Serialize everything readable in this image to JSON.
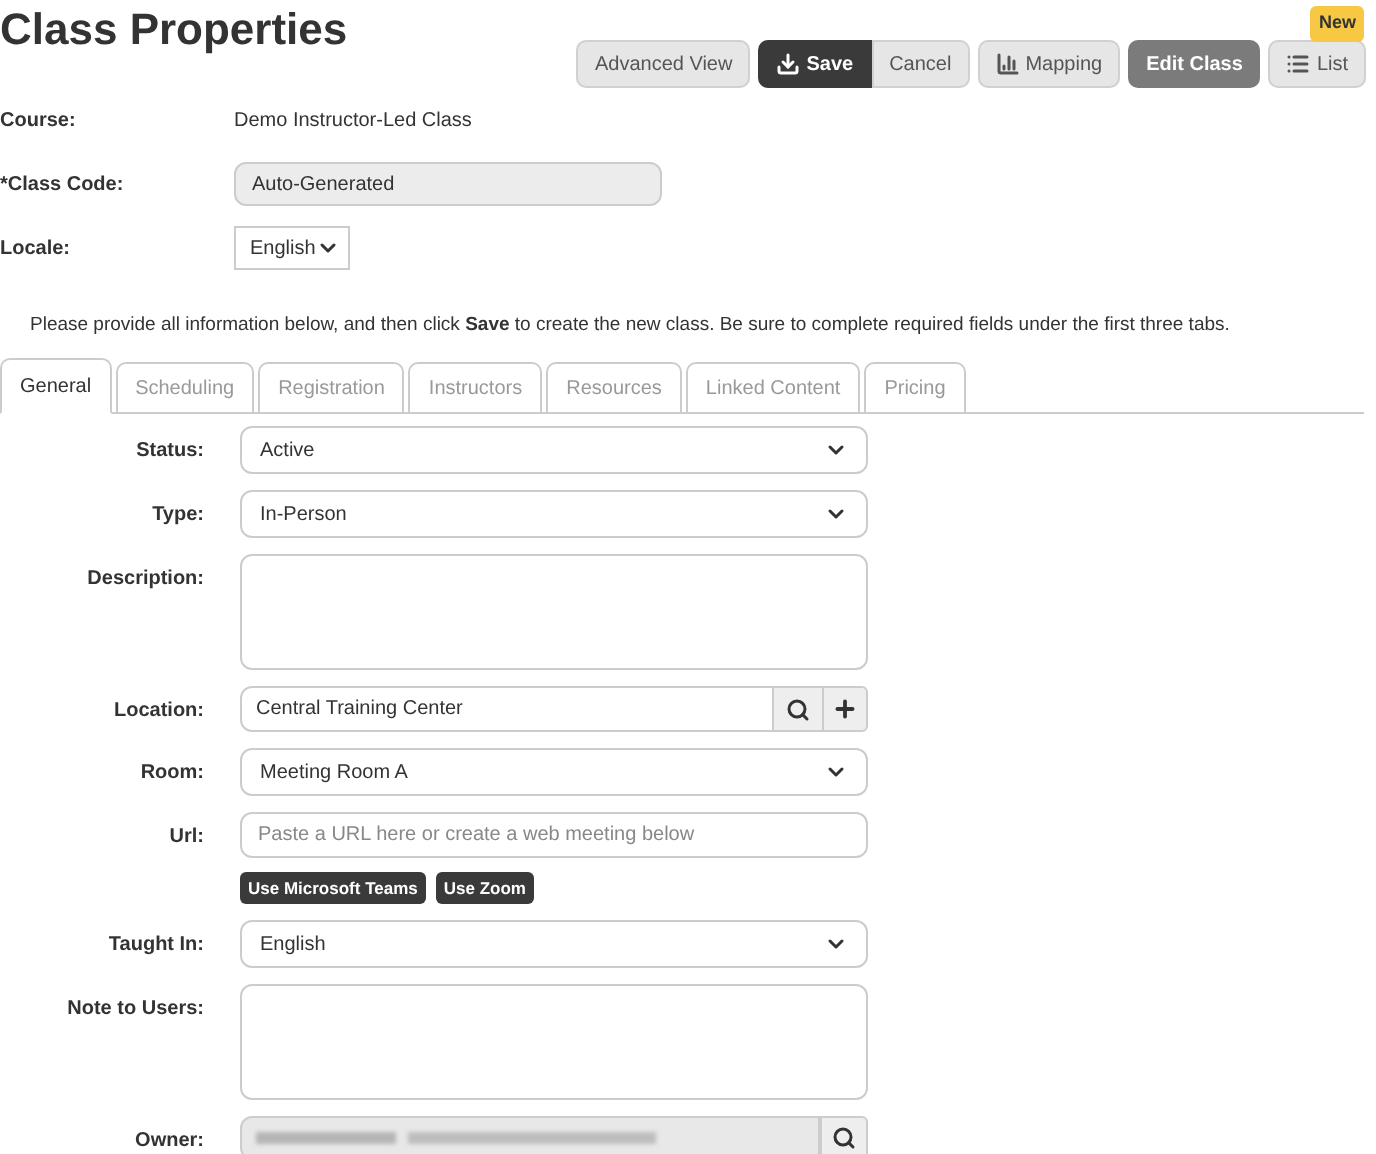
{
  "page": {
    "title": "Class Properties",
    "badge": "New"
  },
  "toolbar": [
    [
      {
        "label": "Advanced View",
        "kind": "view"
      }
    ],
    [
      {
        "label": "Save",
        "kind": "save"
      },
      {
        "label": "Cancel",
        "kind": "cancel"
      }
    ],
    [
      {
        "label": "Mapping",
        "kind": "mapping"
      }
    ],
    [
      {
        "label": "Edit Class",
        "kind": "edit"
      }
    ],
    [
      {
        "label": "List",
        "kind": "list"
      }
    ]
  ],
  "header_fields": [
    {
      "label": "Course:",
      "kind": "static",
      "value": "Demo Instructor-Led Class"
    },
    {
      "label": "*Class Code:",
      "kind": "readonly",
      "value": "Auto-Generated"
    },
    {
      "label": "Locale:",
      "kind": "small-select",
      "value": "English"
    }
  ],
  "info": "Please provide all information below, and then click **Save** to create the new class. Be sure to complete required fields under the first three tabs.",
  "tabs": [
    {
      "label": "General",
      "selected": true
    },
    {
      "label": "Scheduling",
      "selected": false
    },
    {
      "label": "Registration",
      "selected": false
    },
    {
      "label": "Instructors",
      "selected": false
    },
    {
      "label": "Resources",
      "selected": false
    },
    {
      "label": "Linked Content",
      "selected": false
    },
    {
      "label": "Pricing",
      "selected": false
    }
  ],
  "form": [
    {
      "label": "Status:",
      "kind": "select",
      "value": "Active"
    },
    {
      "label": "Type:",
      "kind": "select",
      "value": "In-Person"
    },
    {
      "label": "Description:",
      "kind": "textarea"
    },
    {
      "label": "Location:",
      "kind": "lookup",
      "value": "Central Training Center"
    },
    {
      "label": "Room:",
      "kind": "select",
      "value": "Meeting Room A"
    },
    {
      "label": "Url:",
      "kind": "text",
      "placeholder": "Paste a URL here or create a web meeting below",
      "buttons": [
        "Use Microsoft Teams",
        "Use Zoom"
      ]
    },
    {
      "label": "Taught In:",
      "kind": "select",
      "value": "English"
    },
    {
      "label": "Note to Users:",
      "kind": "textarea"
    },
    {
      "label": "Owner:",
      "kind": "redacted-lookup"
    }
  ]
}
